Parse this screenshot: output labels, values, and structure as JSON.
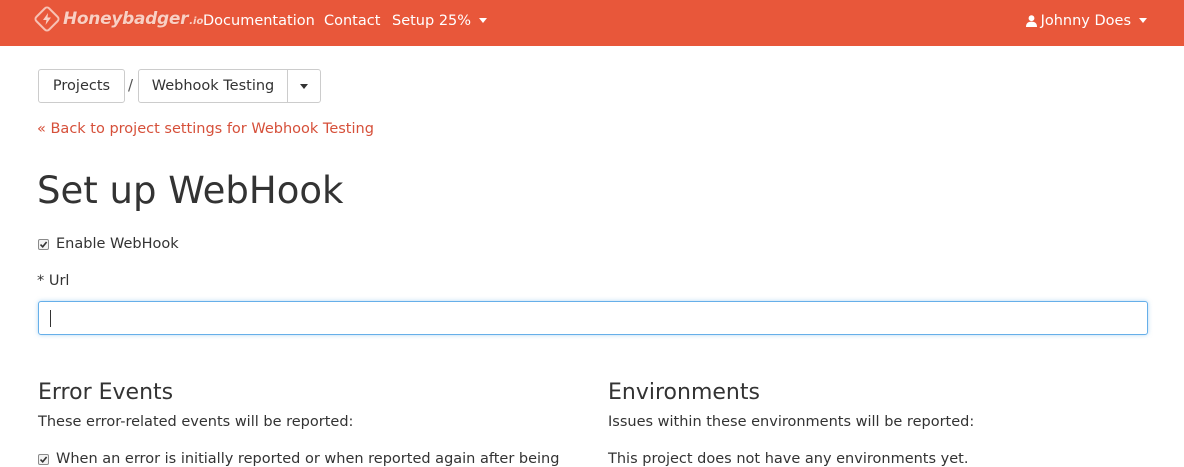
{
  "navbar": {
    "brand": {
      "name": "Honeybadger",
      "tld": ".io",
      "icon": "lightning-bolt-icon"
    },
    "links": [
      {
        "label": "Documentation"
      },
      {
        "label": "Contact"
      },
      {
        "label": "Setup 25%",
        "has_dropdown": true
      }
    ],
    "user": {
      "name": "Johnny Does",
      "icon": "user-icon",
      "has_dropdown": true
    },
    "background_color": "#e8573a"
  },
  "breadcrumb": {
    "root": "Projects",
    "separator": "/",
    "current": "Webhook Testing"
  },
  "back_link": "« Back to project settings for Webhook Testing",
  "page_title": "Set up WebHook",
  "enable": {
    "label": "Enable WebHook",
    "checked": true
  },
  "url_field": {
    "label": "* Url",
    "value": "",
    "placeholder": ""
  },
  "error_events": {
    "title": "Error Events",
    "description": "These error-related events will be reported:",
    "first_option": "When an error is initially reported or when reported again after being"
  },
  "environments": {
    "title": "Environments",
    "description": "Issues within these environments will be reported:",
    "empty_message": "This project does not have any environments yet."
  },
  "colors": {
    "accent": "#e8573a",
    "link": "#d6503a",
    "focus": "#66afe9"
  }
}
